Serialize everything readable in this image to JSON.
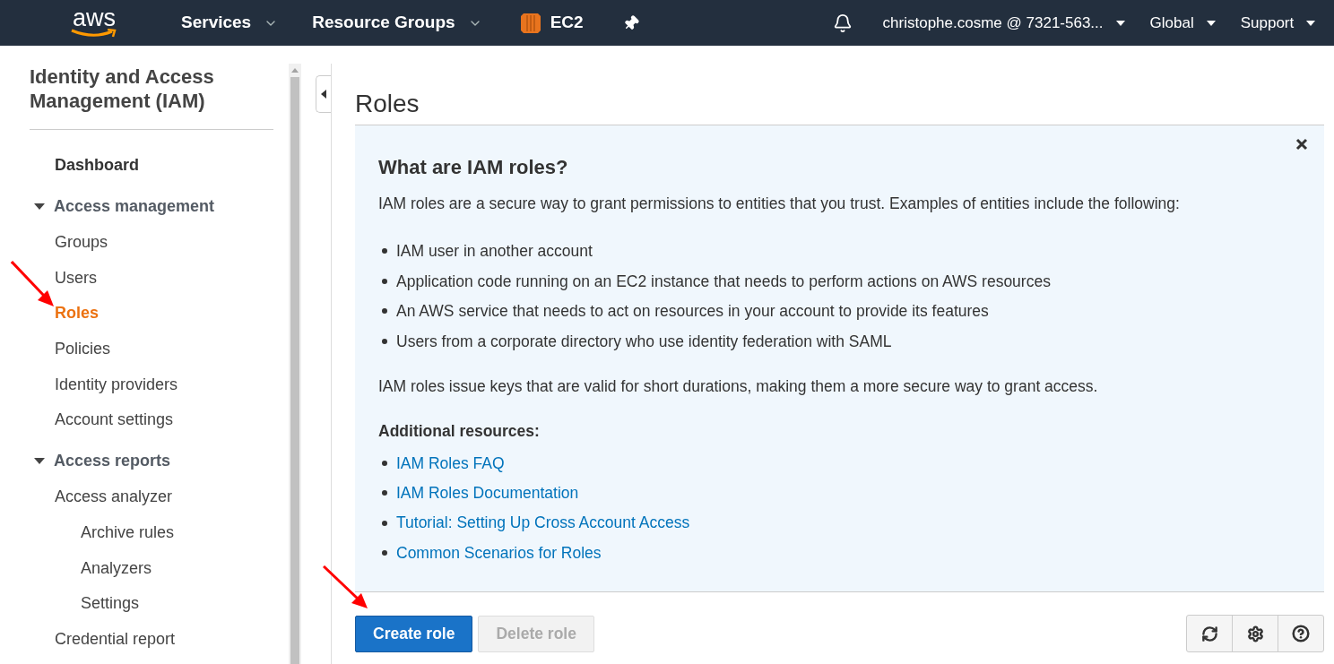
{
  "topnav": {
    "logo": "aws",
    "menus": [
      {
        "label": "Services",
        "kind": "menu"
      },
      {
        "label": "Resource Groups",
        "kind": "menu"
      },
      {
        "label": "EC2",
        "kind": "service"
      }
    ],
    "right_menus": [
      {
        "label": "christophe.cosme @ 7321-563..."
      },
      {
        "label": "Global"
      },
      {
        "label": "Support"
      }
    ]
  },
  "sidebar": {
    "title": "Identity and Access Management (IAM)",
    "items": [
      {
        "label": "Dashboard",
        "kind": "top",
        "selected": false
      },
      {
        "label": "Access management",
        "kind": "section",
        "expanded": true,
        "children": [
          {
            "label": "Groups",
            "selected": false
          },
          {
            "label": "Users",
            "selected": false
          },
          {
            "label": "Roles",
            "selected": true
          },
          {
            "label": "Policies",
            "selected": false
          },
          {
            "label": "Identity providers",
            "selected": false
          },
          {
            "label": "Account settings",
            "selected": false
          }
        ]
      },
      {
        "label": "Access reports",
        "kind": "section",
        "expanded": true,
        "children": [
          {
            "label": "Access analyzer",
            "selected": false,
            "children": [
              {
                "label": "Archive rules",
                "selected": false
              },
              {
                "label": "Analyzers",
                "selected": false
              },
              {
                "label": "Settings",
                "selected": false
              }
            ]
          },
          {
            "label": "Credential report",
            "selected": false
          }
        ]
      }
    ]
  },
  "page": {
    "title": "Roles",
    "info": {
      "heading": "What are IAM roles?",
      "intro": "IAM roles are a secure way to grant permissions to entities that you trust. Examples of entities include the following:",
      "bullets": [
        "IAM user in another account",
        "Application code running on an EC2 instance that needs to perform actions on AWS resources",
        "An AWS service that needs to act on resources in your account to provide its features",
        "Users from a corporate directory who use identity federation with SAML"
      ],
      "note": "IAM roles issue keys that are valid for short durations, making them a more secure way to grant access.",
      "resources_label": "Additional resources:",
      "links": [
        "IAM Roles FAQ",
        "IAM Roles Documentation",
        "Tutorial: Setting Up Cross Account Access",
        "Common Scenarios for Roles"
      ]
    },
    "buttons": [
      {
        "label": "Create role",
        "kind": "primary",
        "disabled": false
      },
      {
        "label": "Delete role",
        "kind": "secondary",
        "disabled": true
      }
    ]
  }
}
